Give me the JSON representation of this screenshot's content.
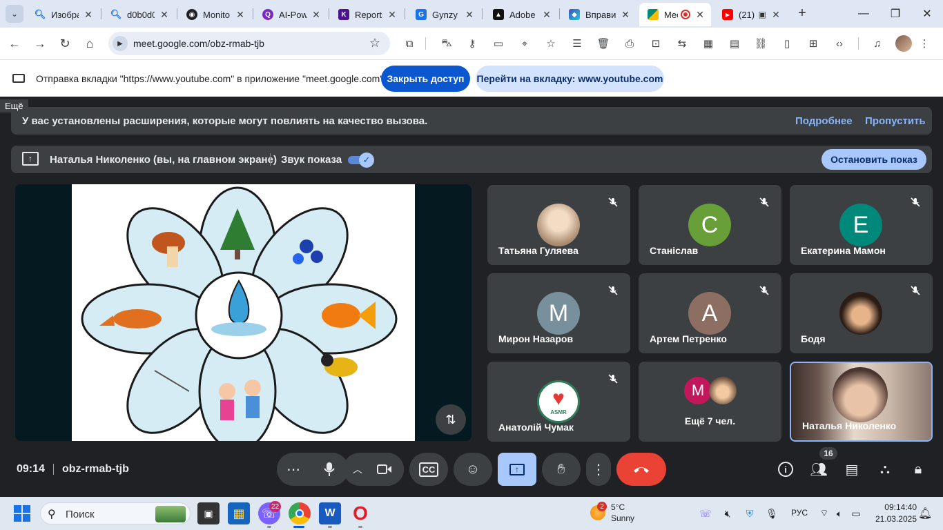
{
  "browser": {
    "tabs": [
      {
        "title": "Изобра",
        "icon_color": "#1a73e8",
        "icon_glyph": "🔍"
      },
      {
        "title": "d0b0d0",
        "icon_color": "#1a73e8",
        "icon_glyph": "🔍"
      },
      {
        "title": "Monito",
        "icon_color": "#202124",
        "icon_glyph": "◉"
      },
      {
        "title": "AI-Pow",
        "icon_color": "#7b2cbf",
        "icon_glyph": "Q"
      },
      {
        "title": "Reports",
        "icon_color": "#4a148c",
        "icon_glyph": "K!"
      },
      {
        "title": "Gynzy",
        "icon_color": "#1a73e8",
        "icon_glyph": "G"
      },
      {
        "title": "Adobe",
        "icon_color": "#111111",
        "icon_glyph": "▲"
      },
      {
        "title": "Вправи",
        "icon_color": "#3f51b5",
        "icon_glyph": "◆"
      },
      {
        "title": "Mee",
        "icon_color": "#00897b",
        "icon_glyph": "▶",
        "active": true
      },
      {
        "title": "(21)",
        "icon_color": "#ff0000",
        "icon_glyph": "▶"
      }
    ],
    "address": "meet.google.com/obz-rmab-tjb"
  },
  "infobar": {
    "message": "Отправка вкладки \"https://www.youtube.com\" в приложение \"meet.google.com\"...",
    "stop_sharing": "Закрыть доступ",
    "go_to_tab": "Перейти на вкладку: www.youtube.com"
  },
  "meet": {
    "more_label": "Ещё",
    "extension_warning": "У вас установлены расширения, которые могут повлиять на качество вызова.",
    "learn_more": "Подробнее",
    "skip": "Пропустить",
    "presenter": "Наталья Николенко (вы, на главном экране)",
    "share_audio": "Звук показа",
    "stop_presenting": "Остановить показ",
    "participants": [
      {
        "name": "Татьяна Гуляева",
        "initial": "",
        "color": "#c9b8a6",
        "muted": true
      },
      {
        "name": "Станіслав",
        "initial": "С",
        "color": "#689f38",
        "muted": true
      },
      {
        "name": "Екатерина Мамон",
        "initial": "Е",
        "color": "#00897b",
        "muted": true
      },
      {
        "name": "Мирон Назаров",
        "initial": "М",
        "color": "#78909c",
        "muted": true
      },
      {
        "name": "Артем Петренко",
        "initial": "А",
        "color": "#8d6e63",
        "muted": true
      },
      {
        "name": "Бодя",
        "initial": "",
        "color": "#2b1d16",
        "muted": true
      },
      {
        "name": "Анатолій Чумак",
        "initial": "",
        "color": "#ffffff",
        "muted": true
      },
      {
        "name": "Ещё 7 чел.",
        "initial": "М",
        "color": "#c2185b",
        "muted": false
      },
      {
        "name": "Наталья Николенко",
        "initial": "",
        "color": "#5a4b4a",
        "muted": false
      }
    ],
    "avatar_badge_text": "ASMR"
  },
  "controls": {
    "time": "09:14",
    "meeting_code": "obz-rmab-tjb",
    "people_count": "16"
  },
  "taskbar": {
    "search_label": "Поиск",
    "chat_badge": "22",
    "weather_badge": "2",
    "temperature": "5°C",
    "weather": "Sunny",
    "language": "РУС",
    "time": "09:14:40",
    "date": "21.03.2025"
  }
}
